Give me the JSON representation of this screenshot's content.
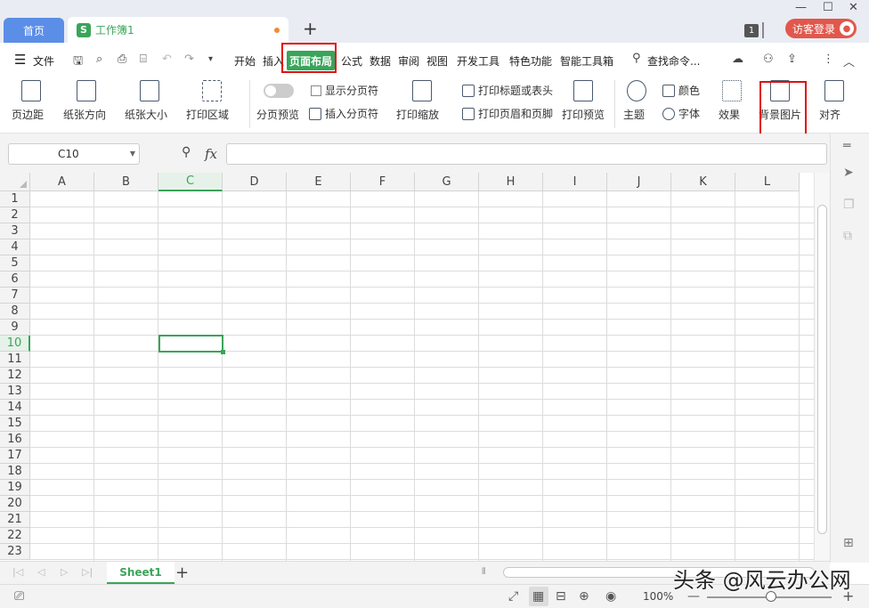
{
  "titlebar": {
    "home_tab": "首页",
    "doc_logo": "S",
    "doc_title": "工作簿1",
    "new_tab": "+",
    "badge": "1",
    "login": "访客登录",
    "min": "—",
    "max": "☐",
    "close": "✕"
  },
  "menu": {
    "file": "文件",
    "items": [
      "开始",
      "插入",
      "页面布局",
      "公式",
      "数据",
      "审阅",
      "视图",
      "开发工具",
      "特色功能",
      "智能工具箱"
    ],
    "active": "页面布局",
    "search": "查找命令..."
  },
  "ribbon": {
    "margins": "页边距",
    "orientation": "纸张方向",
    "size": "纸张大小",
    "print_area": "打印区域",
    "page_break_preview": "分页预览",
    "show_page_breaks": "显示分页符",
    "insert_page_break": "插入分页符",
    "print_scale": "打印缩放",
    "print_titles": "打印标题或表头",
    "header_footer": "打印页眉和页脚",
    "print_preview": "打印预览",
    "theme": "主题",
    "colors": "颜色",
    "fonts": "字体",
    "effects": "效果",
    "background": "背景图片",
    "align": "对齐"
  },
  "formula": {
    "name_box": "C10",
    "fx": "fx",
    "value": ""
  },
  "grid": {
    "columns": [
      "A",
      "B",
      "C",
      "D",
      "E",
      "F",
      "G",
      "H",
      "I",
      "J",
      "K",
      "L"
    ],
    "rows": [
      "1",
      "2",
      "3",
      "4",
      "5",
      "6",
      "7",
      "8",
      "9",
      "10",
      "11",
      "12",
      "13",
      "14",
      "15",
      "16",
      "17",
      "18",
      "19",
      "20",
      "21",
      "22",
      "23"
    ],
    "active_column": "C",
    "active_row": "10"
  },
  "sheets": {
    "tabs": [
      "Sheet1"
    ],
    "add": "+"
  },
  "status": {
    "zoom": "100%",
    "minus": "—",
    "plus": "+"
  },
  "watermark": "头条 @风云办公网",
  "colors": {
    "accent": "#3aa45a",
    "highlight": "#e01010",
    "home_tab": "#5b8ee6",
    "login": "#e2574c"
  }
}
